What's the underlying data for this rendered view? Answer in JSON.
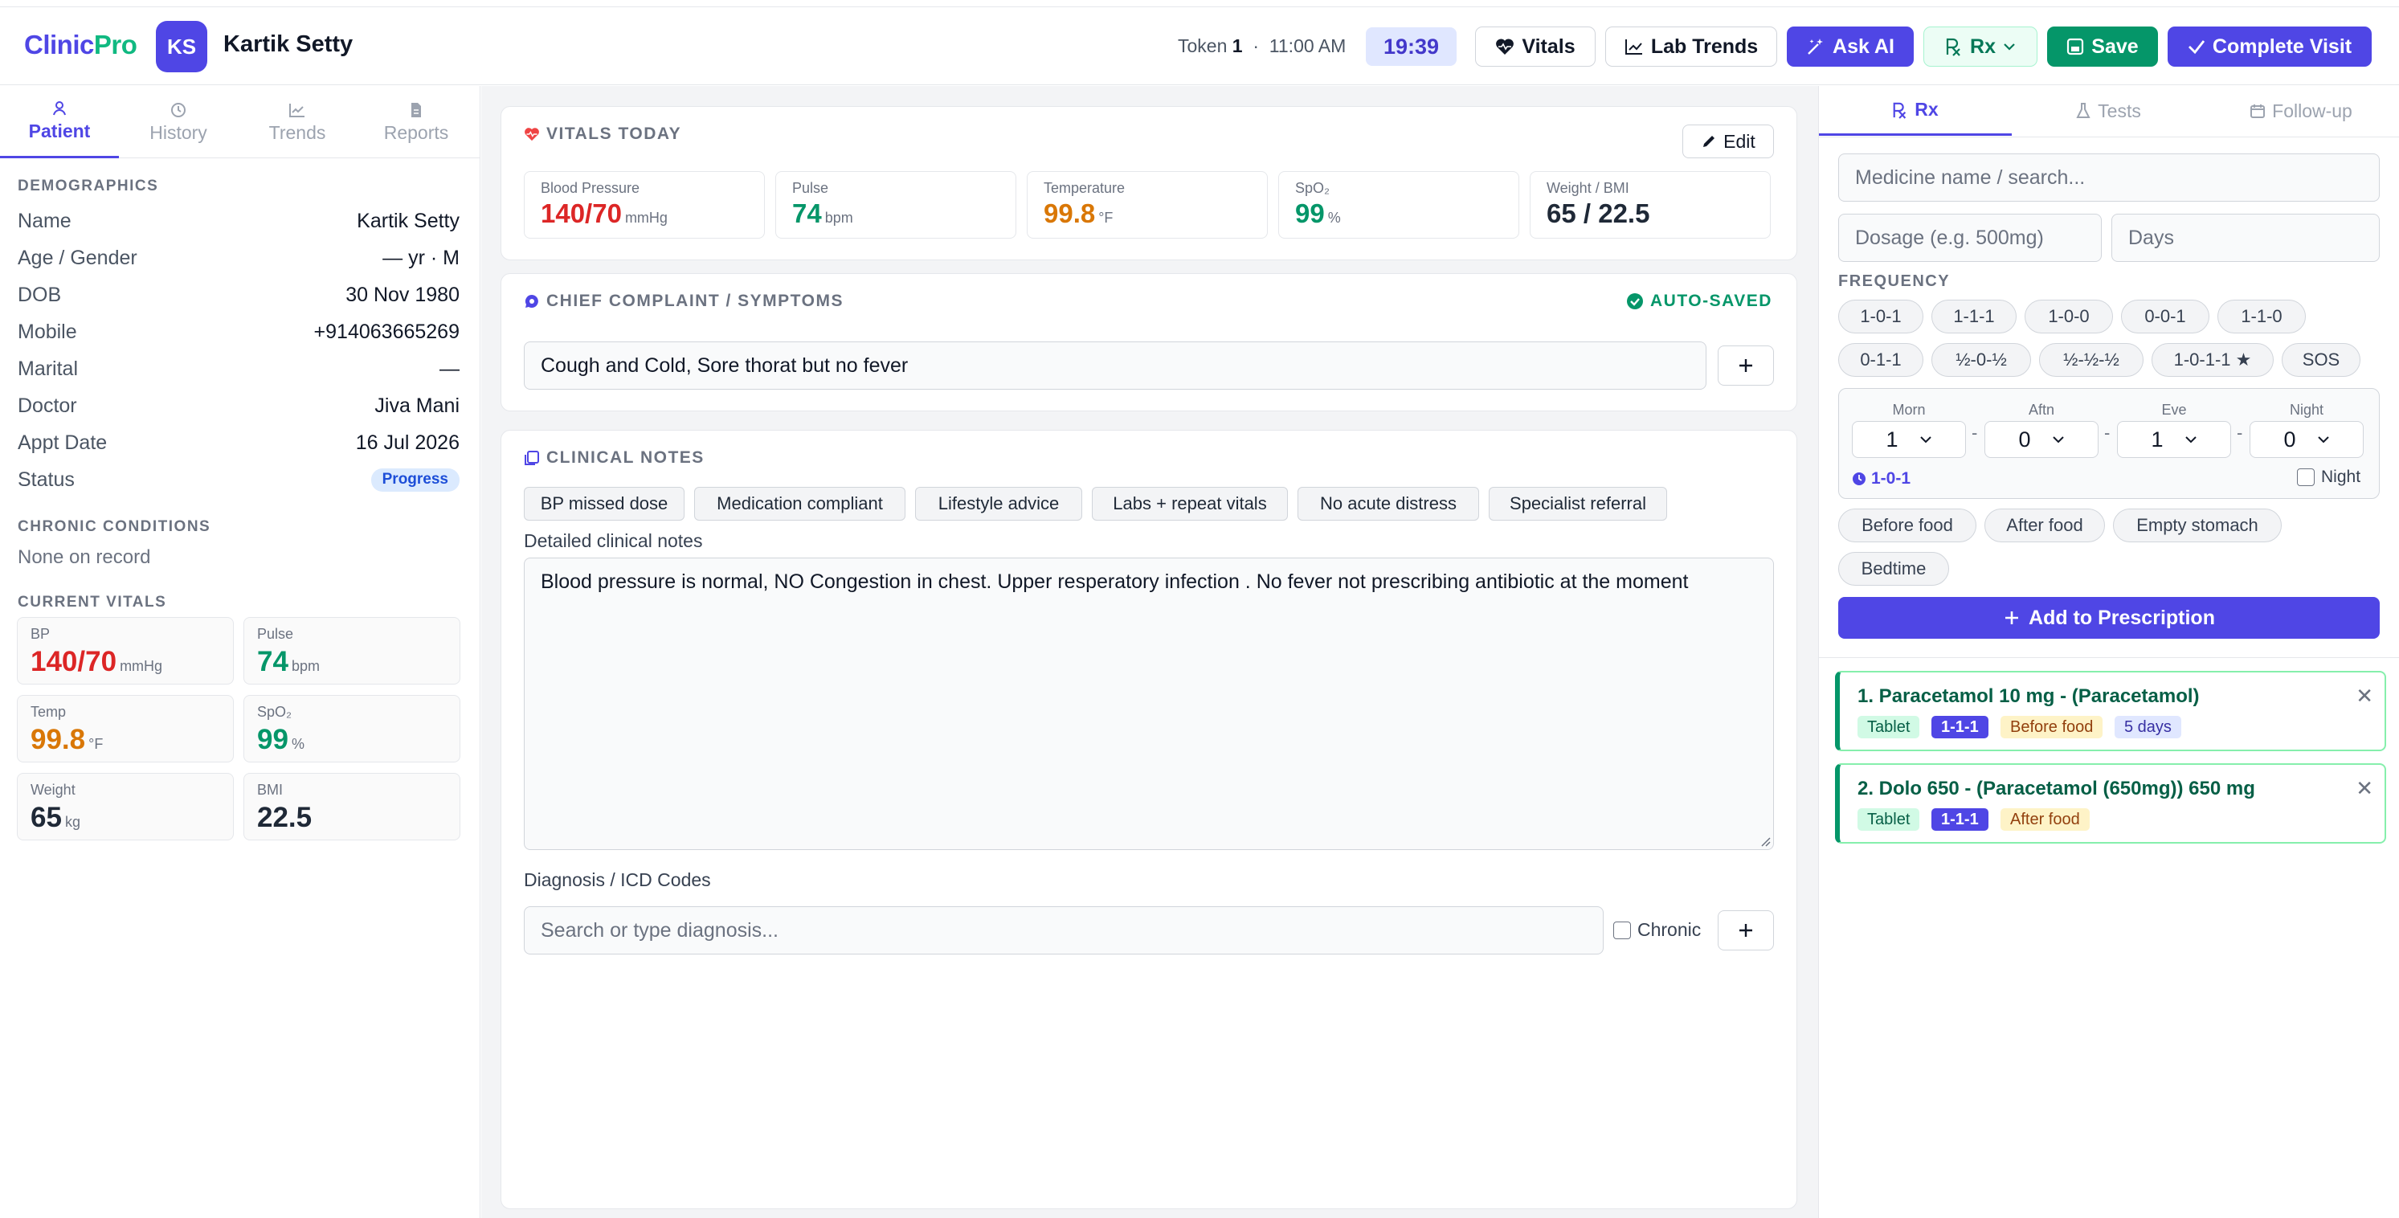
{
  "app": {
    "logo_a": "Clinic",
    "logo_b": "Pro"
  },
  "patient_header": {
    "initials": "KS",
    "name": "Kartik Setty"
  },
  "token": {
    "label": "Token",
    "number": "1",
    "sep": "·",
    "time": "11:00 AM"
  },
  "clock": "19:39",
  "toolbar": {
    "vitals": "Vitals",
    "lab_trends": "Lab Trends",
    "ask_ai": "Ask AI",
    "rx": "Rx",
    "save": "Save",
    "complete": "Complete Visit"
  },
  "left_tabs": [
    "Patient",
    "History",
    "Trends",
    "Reports"
  ],
  "demographics": {
    "title": "DEMOGRAPHICS",
    "rows": [
      {
        "k": "Name",
        "v": "Kartik Setty"
      },
      {
        "k": "Age / Gender",
        "v": "— yr · M"
      },
      {
        "k": "DOB",
        "v": "30 Nov 1980"
      },
      {
        "k": "Mobile",
        "v": "+914063665269"
      },
      {
        "k": "Marital",
        "v": "—"
      },
      {
        "k": "Doctor",
        "v": "Jiva Mani"
      },
      {
        "k": "Appt Date",
        "v": "16 Jul 2026"
      },
      {
        "k": "Status",
        "v": "Progress"
      }
    ]
  },
  "chronic": {
    "title": "CHRONIC CONDITIONS",
    "value": "None on record"
  },
  "current_vitals": {
    "title": "CURRENT VITALS",
    "items": [
      {
        "label": "BP",
        "value": "140/70",
        "unit": "mmHg",
        "color": "#dc2626"
      },
      {
        "label": "Pulse",
        "value": "74",
        "unit": "bpm",
        "color": "#059669"
      },
      {
        "label": "Temp",
        "value": "99.8",
        "unit": "°F",
        "color": "#d97706"
      },
      {
        "label": "SpO₂",
        "value": "99",
        "unit": "%",
        "color": "#059669"
      },
      {
        "label": "Weight",
        "value": "65",
        "unit": "kg",
        "color": "#111827"
      },
      {
        "label": "BMI",
        "value": "22.5",
        "unit": "",
        "color": "#111827"
      }
    ]
  },
  "vitals_today": {
    "title": "VITALS TODAY",
    "edit": "Edit",
    "items": [
      {
        "label": "Blood Pressure",
        "value": "140/70",
        "unit": "mmHg",
        "color": "#dc2626"
      },
      {
        "label": "Pulse",
        "value": "74",
        "unit": "bpm",
        "color": "#059669"
      },
      {
        "label": "Temperature",
        "value": "99.8",
        "unit": "°F",
        "color": "#d97706"
      },
      {
        "label": "SpO₂",
        "value": "99",
        "unit": "%",
        "color": "#059669"
      },
      {
        "label": "Weight / BMI",
        "value": "65 / 22.5",
        "unit": "",
        "color": "#111827"
      }
    ]
  },
  "complaint": {
    "title": "CHIEF COMPLAINT / SYMPTOMS",
    "status": "AUTO-SAVED",
    "value": "Cough and Cold, Sore thorat but no fever"
  },
  "clinical_notes": {
    "title": "CLINICAL NOTES",
    "chips": [
      "BP missed dose",
      "Medication compliant",
      "Lifestyle advice",
      "Labs + repeat vitals",
      "No acute distress",
      "Specialist referral"
    ],
    "detail_label": "Detailed clinical notes",
    "detail_value": "Blood pressure is normal, NO Congestion in chest. Upper resperatory infection . No fever not prescribing antibiotic at the moment",
    "diagnosis_label": "Diagnosis / ICD Codes",
    "diagnosis_placeholder": "Search or type diagnosis...",
    "chronic_label": "Chronic"
  },
  "right_tabs": [
    "Rx",
    "Tests",
    "Follow-up"
  ],
  "rx_form": {
    "medicine_placeholder": "Medicine name / search...",
    "dosage_placeholder": "Dosage (e.g. 500mg)",
    "days_placeholder": "Days",
    "frequency_title": "FREQUENCY",
    "freq_row1": [
      "1-0-1",
      "1-1-1",
      "1-0-0",
      "0-0-1",
      "1-1-0"
    ],
    "freq_row2": [
      "0-1-1",
      "½-0-½",
      "½-½-½",
      "1-0-1-1 ★",
      "SOS"
    ],
    "slots": [
      {
        "label": "Morn",
        "value": "1"
      },
      {
        "label": "Aftn",
        "value": "0"
      },
      {
        "label": "Eve",
        "value": "1"
      },
      {
        "label": "Night",
        "value": "0"
      }
    ],
    "dash": "-",
    "summary": "1-0-1",
    "night_label": "Night",
    "food": [
      "Before food",
      "After food",
      "Empty stomach",
      "Bedtime"
    ],
    "add_button": "Add to Prescription"
  },
  "prescriptions": [
    {
      "title": "1. Paracetamol 10 mg - (Paracetamol)",
      "form": "Tablet",
      "freq": "1-1-1",
      "food": "Before food",
      "days": "5 days"
    },
    {
      "title": "2. Dolo 650 - (Paracetamol (650mg)) 650 mg",
      "form": "Tablet",
      "freq": "1-1-1",
      "food": "After food"
    }
  ],
  "colors": {
    "accent": "#4f46e5",
    "success": "#059669",
    "danger": "#dc2626",
    "warning": "#d97706"
  }
}
